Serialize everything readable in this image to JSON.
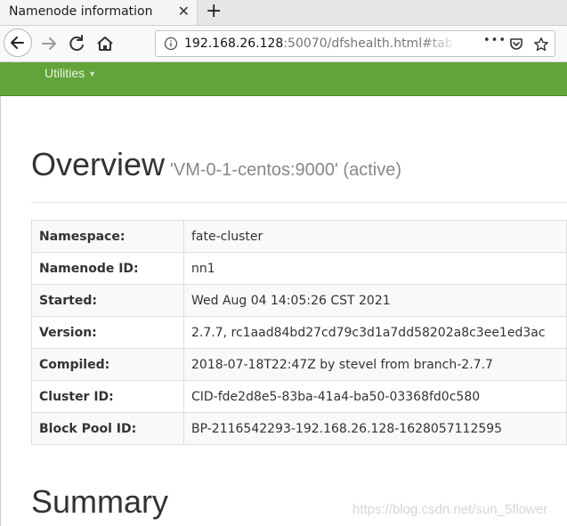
{
  "browser": {
    "tab_title": "Namenode information",
    "close_glyph": "✕",
    "new_tab_glyph": "+",
    "url_host": "192.168.26.128",
    "url_rest": ":50070/dfshealth.html#tab-ove",
    "menu_glyph": "•••"
  },
  "header": {
    "utilities_label": "Utilities"
  },
  "overview": {
    "title": "Overview",
    "subtitle": "'VM-0-1-centos:9000' (active)",
    "rows": [
      {
        "label": "Namespace:",
        "value": "fate-cluster"
      },
      {
        "label": "Namenode ID:",
        "value": "nn1"
      },
      {
        "label": "Started:",
        "value": "Wed Aug 04 14:05:26 CST 2021"
      },
      {
        "label": "Version:",
        "value": "2.7.7, rc1aad84bd27cd79c3d1a7dd58202a8c3ee1ed3ac"
      },
      {
        "label": "Compiled:",
        "value": "2018-07-18T22:47Z by stevel from branch-2.7.7"
      },
      {
        "label": "Cluster ID:",
        "value": "CID-fde2d8e5-83ba-41a4-ba50-03368fd0c580"
      },
      {
        "label": "Block Pool ID:",
        "value": "BP-2116542293-192.168.26.128-1628057112595"
      }
    ]
  },
  "summary": {
    "title": "Summary"
  },
  "watermark": "https://blog.csdn.net/sun_5flower",
  "colors": {
    "header_green": "#62a43a"
  },
  "icons": [
    "back-arrow-icon",
    "forward-arrow-icon",
    "reload-icon",
    "home-icon",
    "info-icon",
    "pocket-icon",
    "star-icon"
  ]
}
